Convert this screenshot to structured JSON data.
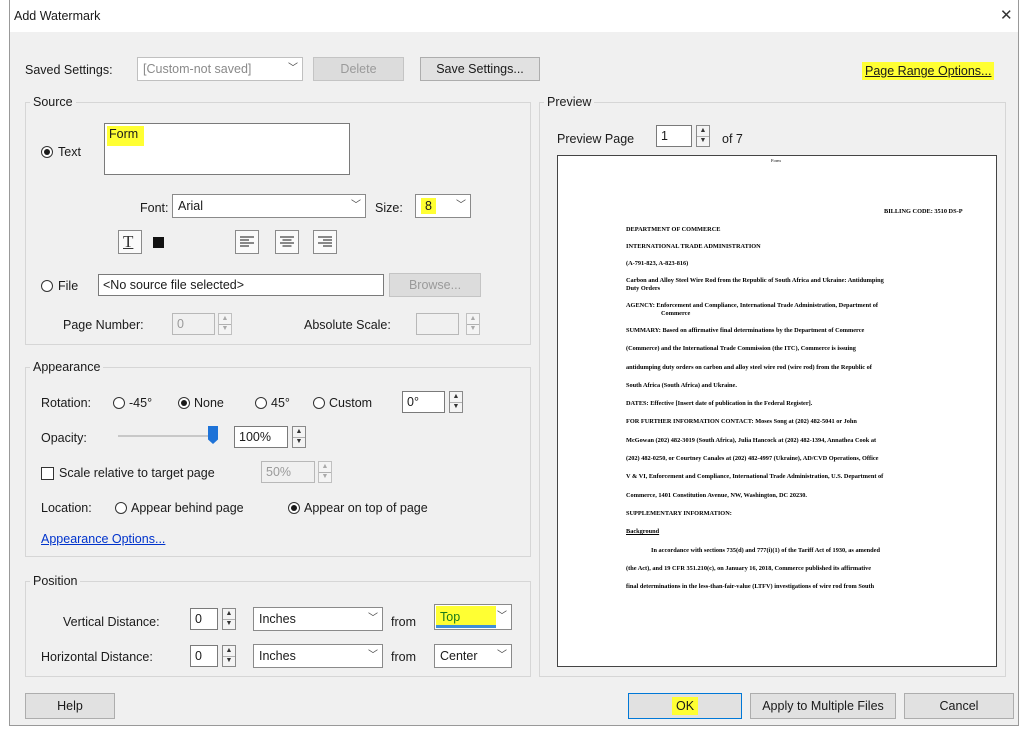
{
  "window": {
    "title": "Add Watermark",
    "close_glyph": "✕"
  },
  "saved_settings": {
    "label": "Saved Settings:",
    "value": "[Custom-not saved]",
    "delete_label": "Delete",
    "save_label": "Save Settings...",
    "page_range_label": "Page Range Options..."
  },
  "source": {
    "group_label": "Source",
    "text_radio_label": "Text",
    "text_value": "Form",
    "font_label": "Font:",
    "font_value": "Arial",
    "size_label": "Size:",
    "size_value": "8",
    "file_radio_label": "File",
    "file_value": "<No source file selected>",
    "browse_label": "Browse...",
    "page_number_label": "Page Number:",
    "page_number_value": "0",
    "abs_scale_label": "Absolute Scale:",
    "abs_scale_value": ""
  },
  "appearance": {
    "group_label": "Appearance",
    "rotation_label": "Rotation:",
    "rot_neg45": "-45°",
    "rot_none": "None",
    "rot_45": "45°",
    "rot_custom": "Custom",
    "rot_value": "0°",
    "opacity_label": "Opacity:",
    "opacity_value": "100%",
    "opacity_fraction": 1.0,
    "scale_label": "Scale relative to target page",
    "scale_value": "50%",
    "location_label": "Location:",
    "behind_label": "Appear behind page",
    "ontop_label": "Appear on top of page",
    "options_link": "Appearance Options..."
  },
  "position": {
    "group_label": "Position",
    "vertical_label": "Vertical Distance:",
    "vertical_value": "0",
    "vertical_units": "Inches",
    "vertical_from_label": "from",
    "vertical_from": "Top",
    "horizontal_label": "Horizontal Distance:",
    "horizontal_value": "0",
    "horizontal_units": "Inches",
    "horizontal_from_label": "from",
    "horizontal_from": "Center"
  },
  "preview": {
    "group_label": "Preview",
    "page_label": "Preview Page",
    "page_value": "1",
    "of_label": "of 7",
    "watermark_text": "Form",
    "doc_lines": [
      "BILLING CODE: 3510 DS-P",
      "DEPARTMENT OF COMMERCE",
      "INTERNATIONAL TRADE ADMINISTRATION",
      "(A-791-823, A-823-816)",
      "Carbon and Alloy Steel Wire Rod from the Republic of South Africa and Ukraine:  Antidumping",
      "Duty Orders",
      "AGENCY:   Enforcement and Compliance, International Trade Administration, Department of",
      "Commerce",
      "SUMMARY:  Based on affirmative final determinations by the Department of Commerce",
      "(Commerce) and the International Trade Commission (the ITC), Commerce is issuing",
      "antidumping duty orders on carbon and alloy steel wire rod (wire rod) from the Republic of",
      "South Africa (South Africa) and Ukraine.",
      "DATES:  Effective [Insert date of publication in the Federal Register].",
      "FOR FURTHER INFORMATION CONTACT:  Moses Song at (202) 482-5041 or John",
      "McGowan (202) 482-3019 (South Africa), Julia Hancock at (202) 482-1394, Annathea Cook at",
      "(202) 482-0250, or Courtney Canales at (202) 482-4997 (Ukraine), AD/CVD Operations, Office",
      "V & VI, Enforcement and Compliance, International Trade Administration, U.S. Department of",
      "Commerce, 1401 Constitution Avenue, NW, Washington, DC 20230.",
      "SUPPLEMENTARY INFORMATION:",
      "Background",
      "In accordance with sections 735(d) and 777(i)(1) of the Tariff Act of 1930, as amended",
      "(the Act), and 19 CFR 351.210(c), on January 16, 2018, Commerce published its affirmative",
      "final determinations in the less-than-fair-value (LTFV) investigations of wire rod from South"
    ]
  },
  "footer": {
    "help_label": "Help",
    "ok_label": "OK",
    "apply_label": "Apply to Multiple Files",
    "cancel_label": "Cancel"
  },
  "colors": {
    "highlight": "#ffff33",
    "link": "#0033cc",
    "slider_thumb": "#1e73d8",
    "dialog_bg": "#f0f0f0"
  }
}
